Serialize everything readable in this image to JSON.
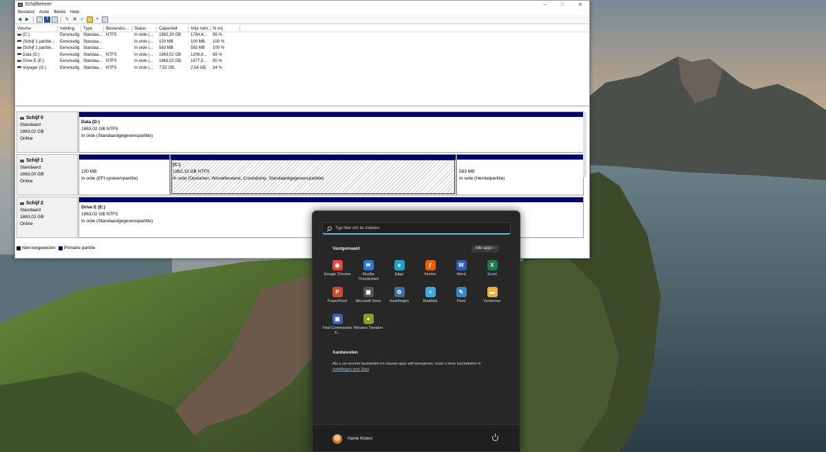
{
  "window": {
    "title": "Schijfbeheer",
    "controls": [
      "–",
      "□",
      "✕"
    ],
    "menu": [
      "Bestand",
      "Actie",
      "Beeld",
      "Help"
    ]
  },
  "volumes": {
    "headers": [
      "Volume",
      "Indeling",
      "Type",
      "Bestandss...",
      "Status",
      "Capaciteit",
      "Vrije ruim...",
      "% vrij"
    ],
    "rows": [
      [
        "(C:)",
        "Eenvoudig",
        "Standaa...",
        "NTFS",
        "In orde (...",
        "1862,33 GB",
        "1784,4...",
        "96 %"
      ],
      [
        "(Schijf 1 partitie...",
        "Eenvoudig",
        "Standaa...",
        "",
        "In orde (...",
        "100 MB",
        "100 MB",
        "100 %"
      ],
      [
        "(Schijf 1 partitie...",
        "Eenvoudig",
        "Standaa...",
        "",
        "In orde (...",
        "583 MB",
        "583 MB",
        "100 %"
      ],
      [
        "Data (D:)",
        "Eenvoudig",
        "Standaa...",
        "NTFS",
        "In orde (...",
        "1863,02 GB",
        "1206,8...",
        "65 %"
      ],
      [
        "Drive E (E:)",
        "Eenvoudig",
        "Standaa...",
        "NTFS",
        "In orde (...",
        "1863,02 GB",
        "1677,5...",
        "90 %"
      ],
      [
        "Voyager (G:)",
        "Eenvoudig",
        "Standaa...",
        "NTFS",
        "In orde (...",
        "7,52 GB",
        "2,54 GB",
        "34 %"
      ]
    ]
  },
  "disks": [
    {
      "name": "Schijf 0",
      "type": "Standaard",
      "size": "1863,02 GB",
      "state": "Online",
      "partitions": [
        {
          "title": "Data  (D:)",
          "size": "1863,02 GB NTFS",
          "status": "In orde (Standaardgegevenspartitie)"
        }
      ]
    },
    {
      "name": "Schijf 1",
      "type": "Standaard",
      "size": "1863,00 GB",
      "state": "Online",
      "partitions": [
        {
          "title": "",
          "size": "100 MB",
          "status": "In orde (EFI-systeempartitie)"
        },
        {
          "title": "(C:)",
          "size": "1862,33 GB NTFS",
          "status": "In orde (Opstarten, Wisselbestand, Crashdump, Standaardgegevenspartitie)"
        },
        {
          "title": "",
          "size": "583 MB",
          "status": "In orde (Herstelpartitie)"
        }
      ]
    },
    {
      "name": "Schijf 2",
      "type": "Standaard",
      "size": "1863,02 GB",
      "state": "Online",
      "partitions": [
        {
          "title": "Drive E  (E:)",
          "size": "1863,02 GB NTFS",
          "status": "In orde (Standaardgegevenspartitie)"
        }
      ]
    }
  ],
  "legend": {
    "unallocated": "Niet-toegewezen",
    "primary": "Primaire partitie",
    "colors": {
      "unallocated": "#000000",
      "primary": "#00007f"
    }
  },
  "start": {
    "search_placeholder": "Typ hier om te zoeken",
    "pinned_title": "Vastgemaakt",
    "all_apps": "Alle apps  ›",
    "apps": [
      {
        "label": "Google Chrome",
        "icon": "chrome-icon",
        "color": "#e8453c",
        "glyph": "◉"
      },
      {
        "label": "Mozilla Thunderbird",
        "icon": "thunderbird-icon",
        "color": "#2a79d0",
        "glyph": "✉"
      },
      {
        "label": "Edge",
        "icon": "edge-icon",
        "color": "#1da1c8",
        "glyph": "e"
      },
      {
        "label": "Firefox",
        "icon": "firefox-icon",
        "color": "#e66000",
        "glyph": "ƒ"
      },
      {
        "label": "Word",
        "icon": "word-icon",
        "color": "#2b5fb4",
        "glyph": "W"
      },
      {
        "label": "Excel",
        "icon": "excel-icon",
        "color": "#1d7a45",
        "glyph": "X"
      },
      {
        "label": "PowerPoint",
        "icon": "powerpoint-icon",
        "color": "#d24726",
        "glyph": "P"
      },
      {
        "label": "Microsoft Store",
        "icon": "store-icon",
        "color": "#555555",
        "glyph": "▦"
      },
      {
        "label": "Instellingen",
        "icon": "settings-icon",
        "color": "#3a6ea5",
        "glyph": "⚙"
      },
      {
        "label": "Kladblok",
        "icon": "notepad-icon",
        "color": "#3fa9e0",
        "glyph": "≡"
      },
      {
        "label": "Paint",
        "icon": "paint-icon",
        "color": "#2e8bd6",
        "glyph": "✎"
      },
      {
        "label": "Verkenner",
        "icon": "explorer-icon",
        "color": "#e8b53a",
        "glyph": "▬"
      },
      {
        "label": "Total Commander 6...",
        "icon": "total-commander-icon",
        "color": "#3a5fbf",
        "glyph": "▣"
      },
      {
        "label": "Winaero Tweaker",
        "icon": "winaero-icon",
        "color": "#8a9a2a",
        "glyph": "●"
      }
    ],
    "recommended_title": "Aanbevolen",
    "recommended_text": "Als u uw recente bestanden en nieuwe apps wilt weergeven, moet u deze inschakelen in",
    "recommended_link": "Instellingen voor Start",
    "user_name": "Harrie Kisters"
  }
}
